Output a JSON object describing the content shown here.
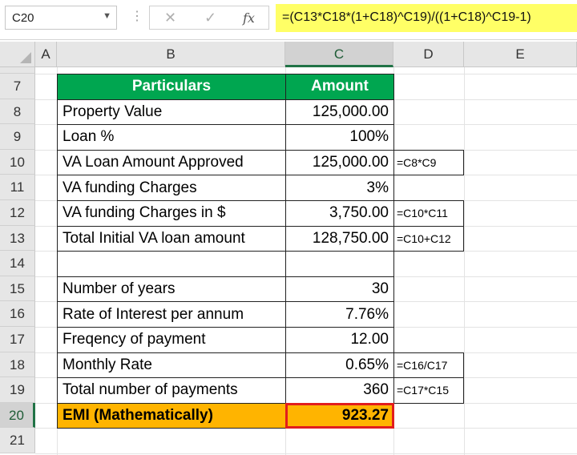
{
  "formula_bar": {
    "name_box": "C20",
    "cancel_icon": "✕",
    "enter_icon": "✓",
    "fx_icon": "fx",
    "formula": "=(C13*C18*(1+C18)^C19)/((1+C18)^C19-1)"
  },
  "columns": [
    "A",
    "B",
    "C",
    "D",
    "E"
  ],
  "rows": [
    "7",
    "8",
    "9",
    "10",
    "11",
    "12",
    "13",
    "14",
    "15",
    "16",
    "17",
    "18",
    "19",
    "20",
    "21"
  ],
  "table": {
    "header": {
      "particulars": "Particulars",
      "amount": "Amount"
    },
    "rows": [
      {
        "label": "Property Value",
        "value": "125,000.00",
        "note": ""
      },
      {
        "label": "Loan %",
        "value": "100%",
        "note": ""
      },
      {
        "label": "VA Loan Amount Approved",
        "value": "125,000.00",
        "note": "=C8*C9"
      },
      {
        "label": "VA funding Charges",
        "value": "3%",
        "note": ""
      },
      {
        "label": "VA funding Charges in $",
        "value": "3,750.00",
        "note": "=C10*C11"
      },
      {
        "label": "Total Initial VA loan amount",
        "value": "128,750.00",
        "note": "=C10+C12"
      },
      {
        "label": "",
        "value": "",
        "note": ""
      },
      {
        "label": "Number of years",
        "value": "30",
        "note": ""
      },
      {
        "label": "Rate of Interest per annum",
        "value": "7.76%",
        "note": ""
      },
      {
        "label": "Freqency of payment",
        "value": "12.00",
        "note": ""
      },
      {
        "label": "Monthly Rate",
        "value": "0.65%",
        "note": "=C16/C17"
      },
      {
        "label": "Total number of payments",
        "value": "360",
        "note": "=C17*C15"
      },
      {
        "label": "EMI (Mathematically)",
        "value": "923.27",
        "note": ""
      }
    ]
  },
  "colors": {
    "header_fill": "#00a650",
    "emi_fill": "#ffb400",
    "selection_border": "#e21d1d",
    "formula_highlight": "#ffff66"
  }
}
